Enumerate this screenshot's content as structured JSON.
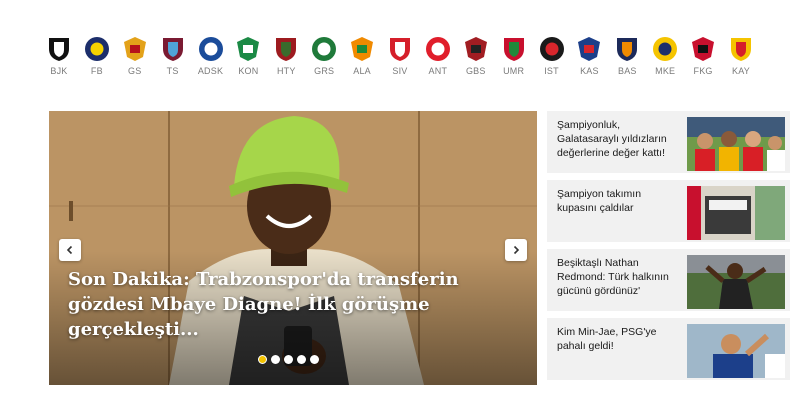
{
  "teams": [
    {
      "code": "BJK",
      "colors": [
        "#111111",
        "#ffffff"
      ],
      "icon": "besiktas-crest-icon"
    },
    {
      "code": "FB",
      "colors": [
        "#1c2e6b",
        "#f5d200"
      ],
      "icon": "fenerbahce-crest-icon"
    },
    {
      "code": "GS",
      "colors": [
        "#e3a21a",
        "#b5121b"
      ],
      "icon": "galatasaray-crest-icon"
    },
    {
      "code": "TS",
      "colors": [
        "#7a1a32",
        "#4fa3d8"
      ],
      "icon": "trabzonspor-crest-icon"
    },
    {
      "code": "ADSK",
      "colors": [
        "#1b4c9a",
        "#ffffff"
      ],
      "icon": "adana-demirspor-crest-icon"
    },
    {
      "code": "KON",
      "colors": [
        "#1b8a45",
        "#ffffff"
      ],
      "icon": "konyaspor-crest-icon"
    },
    {
      "code": "HTY",
      "colors": [
        "#9d1b1f",
        "#3a6b2c"
      ],
      "icon": "hatayspor-crest-icon"
    },
    {
      "code": "GRS",
      "colors": [
        "#1f7a3a",
        "#ffffff"
      ],
      "icon": "giresunspor-crest-icon"
    },
    {
      "code": "ALA",
      "colors": [
        "#f08a00",
        "#1f8a3a"
      ],
      "icon": "alanyaspor-crest-icon"
    },
    {
      "code": "SIV",
      "colors": [
        "#d51f2a",
        "#ffffff"
      ],
      "icon": "sivasspor-crest-icon"
    },
    {
      "code": "ANT",
      "colors": [
        "#e01e2b",
        "#ffffff"
      ],
      "icon": "antalyaspor-crest-icon"
    },
    {
      "code": "GBS",
      "colors": [
        "#a11d22",
        "#222222"
      ],
      "icon": "gaziantep-crest-icon"
    },
    {
      "code": "UMR",
      "colors": [
        "#c8102e",
        "#1f8a3a"
      ],
      "icon": "umraniyespor-crest-icon"
    },
    {
      "code": "IST",
      "colors": [
        "#1a1a1a",
        "#d8262c"
      ],
      "icon": "istanbulspor-crest-icon"
    },
    {
      "code": "KAS",
      "colors": [
        "#1c3f8a",
        "#d8262c"
      ],
      "icon": "kasimpasa-crest-icon"
    },
    {
      "code": "BAS",
      "colors": [
        "#1d2a5a",
        "#f08a00"
      ],
      "icon": "basaksehir-crest-icon"
    },
    {
      "code": "MKE",
      "colors": [
        "#f5c400",
        "#1c2e6b"
      ],
      "icon": "ankaragucu-crest-icon"
    },
    {
      "code": "FKG",
      "colors": [
        "#c8102e",
        "#111111"
      ],
      "icon": "karagumruk-crest-icon"
    },
    {
      "code": "KAY",
      "colors": [
        "#f5c400",
        "#d51f2a"
      ],
      "icon": "kayserispor-crest-icon"
    }
  ],
  "slider": {
    "title": "Son Dakika: Trabzonspor'da transferin gözdesi Mbaye Diagne! İlk görüşme gerçekleşti...",
    "dots": 5,
    "active_dot": 0,
    "accent": "#f2c200"
  },
  "side_news": [
    {
      "title": "Şampiyonluk, Galatasaraylı yıldızların değerlerine değer kattı!"
    },
    {
      "title": "Şampiyon takımın kupasını çaldılar"
    },
    {
      "title": "Beşiktaşlı Nathan Redmond: Türk halkının gücünü gördünüz'"
    },
    {
      "title": "Kim Min-Jae, PSG'ye pahalı geldi!"
    }
  ]
}
